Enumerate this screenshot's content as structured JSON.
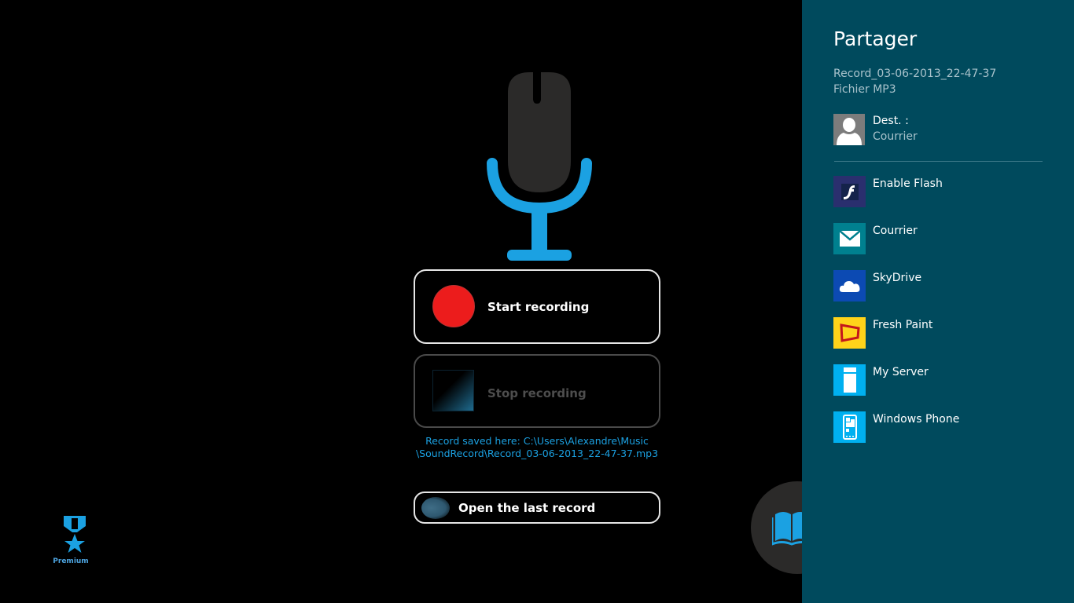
{
  "main": {
    "start_button_label": "Start recording",
    "stop_button_label": "Stop recording",
    "saved_message_line1": "Record saved here: C:\\Users\\Alexandre\\Music",
    "saved_message_line2": "\\SoundRecord\\Record_03-06-2013_22-47-37.mp3",
    "open_last_label": "Open the last record",
    "premium_label": "Premium",
    "colors": {
      "accent": "#1ba1e2",
      "record_red": "#ec1c1c",
      "mic_body": "#2b2a29"
    }
  },
  "share_charm": {
    "title": "Partager",
    "file_name": "Record_03-06-2013_22-47-37",
    "file_type": "Fichier MP3",
    "dest_label": "Dest. :",
    "dest_value": "Courrier",
    "background": "#004a5d",
    "targets": [
      {
        "name": "Enable Flash",
        "icon": "flash-icon",
        "tile_color": "#2a2f6e"
      },
      {
        "name": "Courrier",
        "icon": "mail-icon",
        "tile_color": "#00808f"
      },
      {
        "name": "SkyDrive",
        "icon": "cloud-icon",
        "tile_color": "#0c4ab3"
      },
      {
        "name": "Fresh Paint",
        "icon": "paint-frame-icon",
        "tile_color": "#ffd31a"
      },
      {
        "name": "My Server",
        "icon": "server-icon",
        "tile_color": "#00b0f0"
      },
      {
        "name": "Windows Phone",
        "icon": "phone-icon",
        "tile_color": "#00b0f0"
      }
    ]
  }
}
